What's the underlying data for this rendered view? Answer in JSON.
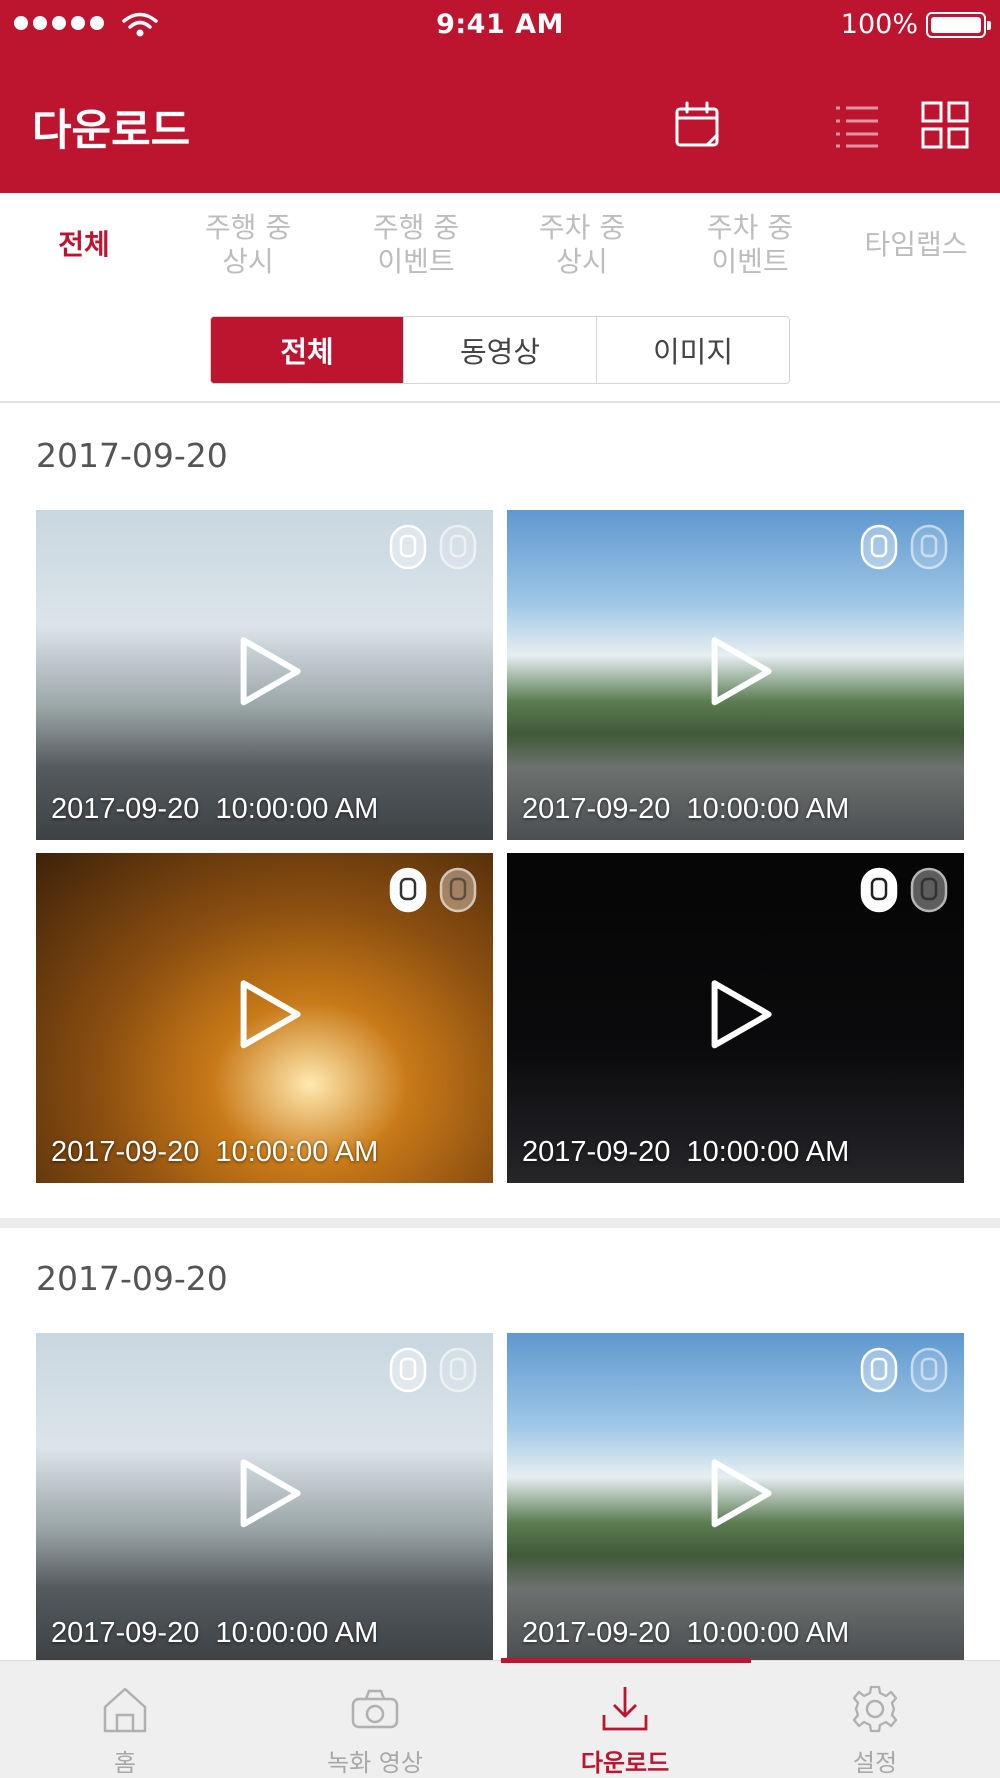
{
  "status_bar": {
    "time": "9:41 AM",
    "battery": "100%"
  },
  "header": {
    "title": "다운로드",
    "icons": [
      "calendar-icon",
      "list-view-icon",
      "grid-view-icon"
    ]
  },
  "category_tabs": [
    {
      "label": "전체",
      "active": true
    },
    {
      "label": "주행 중\n상시",
      "active": false
    },
    {
      "label": "주행 중\n이벤트",
      "active": false
    },
    {
      "label": "주차 중\n상시",
      "active": false
    },
    {
      "label": "주차 중\n이벤트",
      "active": false
    },
    {
      "label": "타임랩스",
      "active": false
    }
  ],
  "media_filter": [
    {
      "label": "전체",
      "active": true
    },
    {
      "label": "동영상",
      "active": false
    },
    {
      "label": "이미지",
      "active": false
    }
  ],
  "groups": [
    {
      "date": "2017-09-20",
      "items": [
        {
          "timestamp": "2017-09-20  10:00:00 AM",
          "scene": "day"
        },
        {
          "timestamp": "2017-09-20  10:00:00 AM",
          "scene": "sky"
        },
        {
          "timestamp": "2017-09-20  10:00:00 AM",
          "scene": "tunnel"
        },
        {
          "timestamp": "2017-09-20  10:00:00 AM",
          "scene": "night"
        }
      ]
    },
    {
      "date": "2017-09-20",
      "items": [
        {
          "timestamp": "2017-09-20  10:00:00 AM",
          "scene": "day"
        },
        {
          "timestamp": "2017-09-20  10:00:00 AM",
          "scene": "sky"
        }
      ]
    }
  ],
  "bottom_nav": [
    {
      "label": "홈",
      "icon": "home-icon",
      "active": false
    },
    {
      "label": "녹화 영상",
      "icon": "camera-icon",
      "active": false
    },
    {
      "label": "다운로드",
      "icon": "download-icon",
      "active": true
    },
    {
      "label": "설정",
      "icon": "settings-icon",
      "active": false
    }
  ],
  "colors": {
    "accent": "#bd1530",
    "inactive": "#bdbdbd",
    "nav_bg": "#efefef"
  }
}
